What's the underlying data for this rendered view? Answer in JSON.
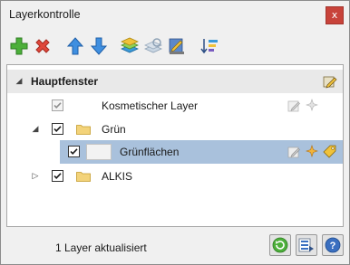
{
  "window": {
    "title": "Layerkontrolle",
    "close_glyph": "x"
  },
  "toolbar": {
    "buttons": [
      {
        "name": "add-layer-button",
        "icon": "plus-icon"
      },
      {
        "name": "remove-layer-button",
        "icon": "delete-x-icon"
      },
      {
        "name": "move-up-button",
        "icon": "arrow-up-icon"
      },
      {
        "name": "move-down-button",
        "icon": "arrow-down-icon"
      },
      {
        "name": "layers-button",
        "icon": "layer-stack-icon"
      },
      {
        "name": "layer-refresh-button",
        "icon": "layer-refresh-icon"
      },
      {
        "name": "layer-properties-button",
        "icon": "layer-edit-icon"
      },
      {
        "name": "layer-sort-button",
        "icon": "sort-icon"
      }
    ]
  },
  "tree": {
    "header": {
      "label": "Hauptfenster",
      "expander": "◢",
      "icon": "map-pen-icon"
    },
    "items": [
      {
        "label": "Kosmetischer Layer",
        "checked": true,
        "disabled": true,
        "icons": [
          "edit-icon",
          "sparkle-icon"
        ]
      },
      {
        "label": "Grün",
        "checked": true,
        "expander": "◢",
        "icon": "folder-icon"
      },
      {
        "label": "Grünflächen",
        "checked": true,
        "selected": true,
        "icons": [
          "edit-icon",
          "sparkle-icon",
          "tag-icon"
        ]
      },
      {
        "label": "ALKIS",
        "checked": true,
        "expander": "▷",
        "icon": "folder-icon"
      }
    ]
  },
  "status": {
    "text": "1 Layer aktualisiert",
    "buttons": [
      {
        "name": "refresh-button",
        "icon": "refresh-icon"
      },
      {
        "name": "layer-list-button",
        "icon": "layer-list-icon"
      },
      {
        "name": "help-button",
        "icon": "help-icon",
        "glyph": "?"
      }
    ]
  },
  "colors": {
    "selection": "#a9c1dc",
    "close_button": "#c8433a",
    "header_row": "#e9e9e9"
  }
}
